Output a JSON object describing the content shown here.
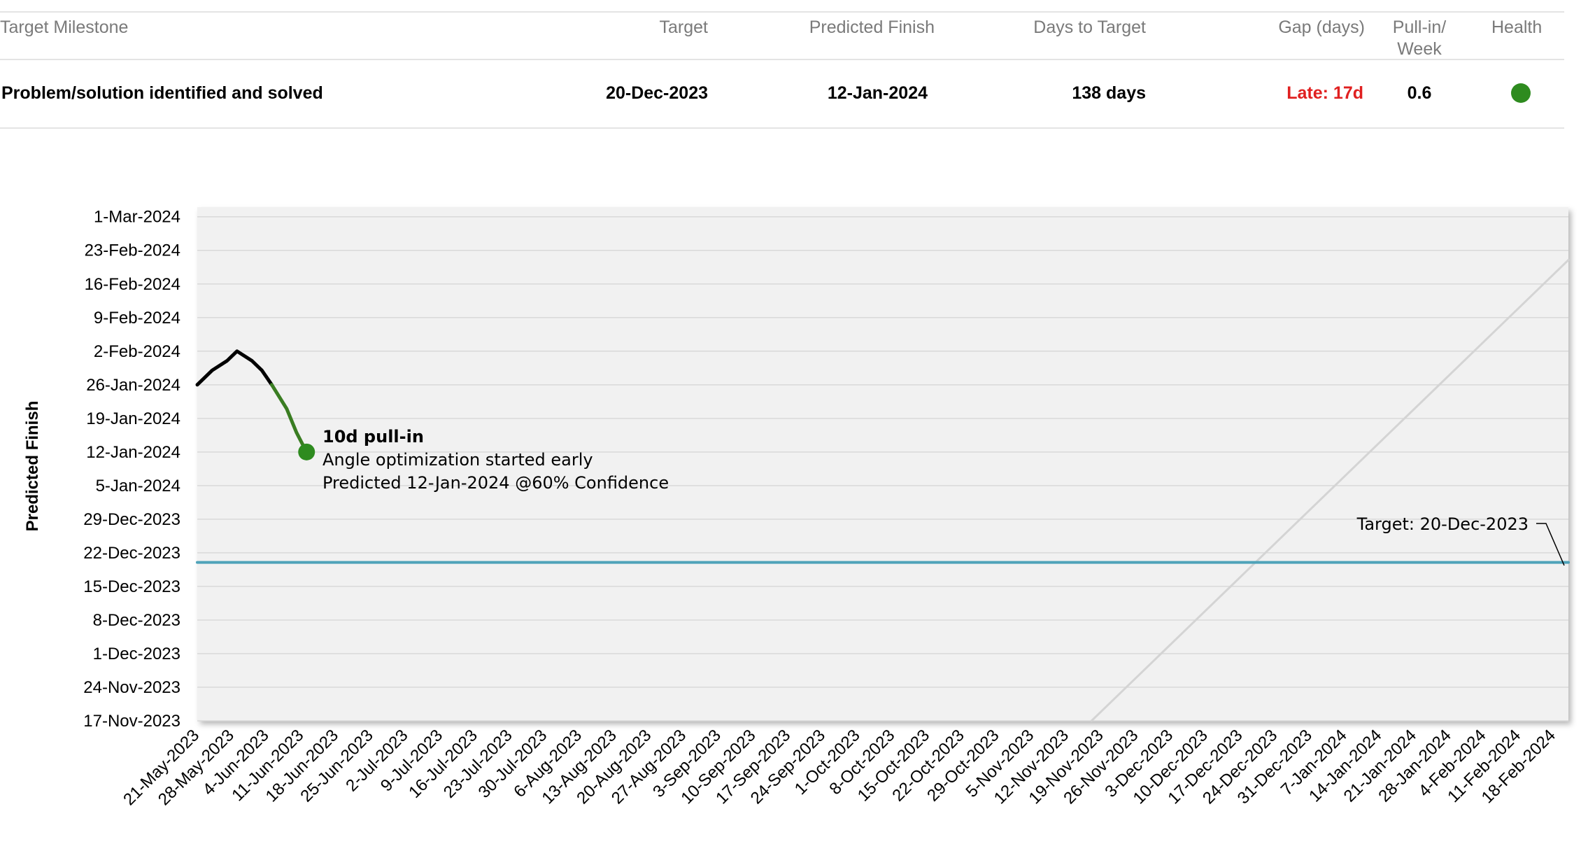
{
  "summary": {
    "headers": {
      "milestone": "Target Milestone",
      "target": "Target",
      "predicted": "Predicted Finish",
      "days": "Days to Target",
      "gap": "Gap (days)",
      "pullin_line1": "Pull-in/",
      "pullin_line2": "Week",
      "health": "Health"
    },
    "row": {
      "milestone": "Problem/solution identified and solved",
      "target": "20-Dec-2023",
      "predicted": "12-Jan-2024",
      "days": "138 days",
      "gap": "Late: 17d",
      "pullin": "0.6",
      "health_color": "#2e8b1f"
    },
    "colors": {
      "late": "#e02020",
      "header": "#7a7a7a"
    }
  },
  "chart_data": {
    "type": "line",
    "ylabel": "Predicted Finish",
    "x_ticks": [
      "21-May-2023",
      "28-May-2023",
      "4-Jun-2023",
      "11-Jun-2023",
      "18-Jun-2023",
      "25-Jun-2023",
      "2-Jul-2023",
      "9-Jul-2023",
      "16-Jul-2023",
      "23-Jul-2023",
      "30-Jul-2023",
      "6-Aug-2023",
      "13-Aug-2023",
      "20-Aug-2023",
      "27-Aug-2023",
      "3-Sep-2023",
      "10-Sep-2023",
      "17-Sep-2023",
      "24-Sep-2023",
      "1-Oct-2023",
      "8-Oct-2023",
      "15-Oct-2023",
      "22-Oct-2023",
      "29-Oct-2023",
      "5-Nov-2023",
      "12-Nov-2023",
      "19-Nov-2023",
      "26-Nov-2023",
      "3-Dec-2023",
      "10-Dec-2023",
      "17-Dec-2023",
      "24-Dec-2023",
      "31-Dec-2023",
      "7-Jan-2024",
      "14-Jan-2024",
      "21-Jan-2024",
      "28-Jan-2024",
      "4-Feb-2024",
      "11-Feb-2024",
      "18-Feb-2024"
    ],
    "y_ticks": [
      "17-Nov-2023",
      "24-Nov-2023",
      "1-Dec-2023",
      "8-Dec-2023",
      "15-Dec-2023",
      "22-Dec-2023",
      "29-Dec-2023",
      "5-Jan-2024",
      "12-Jan-2024",
      "19-Jan-2024",
      "26-Jan-2024",
      "2-Feb-2024",
      "9-Feb-2024",
      "16-Feb-2024",
      "23-Feb-2024",
      "1-Mar-2024"
    ],
    "xlim": [
      "2023-05-21",
      "2024-02-21"
    ],
    "ylim": [
      "2023-11-17",
      "2024-03-03"
    ],
    "series": [
      {
        "role": "history",
        "color": "#000000",
        "points": [
          {
            "x": "2023-05-21",
            "y": "2024-01-26"
          },
          {
            "x": "2023-05-24",
            "y": "2024-01-29"
          },
          {
            "x": "2023-05-27",
            "y": "2024-01-31"
          },
          {
            "x": "2023-05-29",
            "y": "2024-02-02"
          },
          {
            "x": "2023-06-01",
            "y": "2024-01-31"
          },
          {
            "x": "2023-06-03",
            "y": "2024-01-29"
          },
          {
            "x": "2023-06-05",
            "y": "2024-01-26"
          }
        ]
      },
      {
        "role": "pull-in",
        "color": "#3a7d22",
        "points": [
          {
            "x": "2023-06-05",
            "y": "2024-01-26"
          },
          {
            "x": "2023-06-08",
            "y": "2024-01-21"
          },
          {
            "x": "2023-06-10",
            "y": "2024-01-16"
          },
          {
            "x": "2023-06-12",
            "y": "2024-01-12"
          }
        ]
      },
      {
        "role": "target",
        "color": "#4fa3b9",
        "points": [
          {
            "x": "2023-05-21",
            "y": "2023-12-20"
          },
          {
            "x": "2024-02-21",
            "y": "2023-12-20"
          }
        ]
      },
      {
        "role": "today-diagonal",
        "color": "#d4d4d4",
        "points": [
          {
            "x": "2023-11-17",
            "y": "2023-11-17"
          },
          {
            "x": "2024-02-21",
            "y": "2024-02-21"
          }
        ]
      }
    ],
    "marker": {
      "x": "2023-06-12",
      "y": "2024-01-12",
      "color": "#2e8b1f"
    },
    "annotation": {
      "title": "10d pull-in",
      "line1": "Angle optimization started early",
      "line2": "Predicted 12-Jan-2024 @60% Confidence"
    },
    "target_label": "Target: 20-Dec-2023",
    "grid": true
  }
}
